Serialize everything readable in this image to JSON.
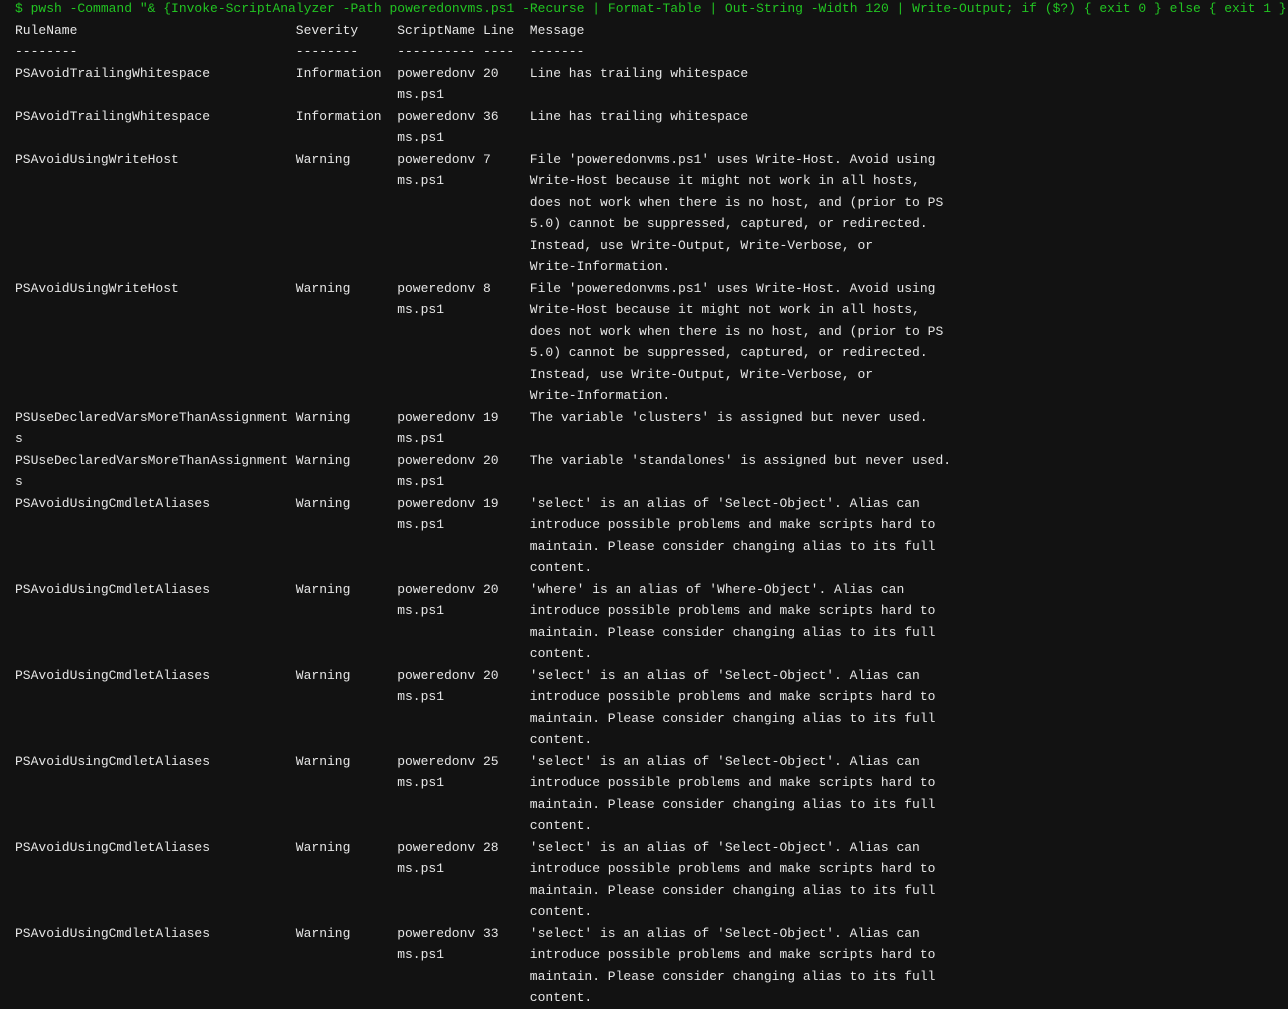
{
  "command": "$ pwsh -Command \"& {Invoke-ScriptAnalyzer -Path poweredonvms.ps1 -Recurse | Format-Table | Out-String -Width 120 | Write-Output; if ($?) { exit 0 } else { exit 1 }",
  "headers": {
    "rule": "RuleName",
    "severity": "Severity",
    "script": "ScriptName",
    "line": "Line",
    "message": "Message"
  },
  "separators": {
    "rule": "--------",
    "severity": "--------",
    "script": "----------",
    "line": "----",
    "message": "-------"
  },
  "rows": [
    {
      "rule": [
        "PSAvoidTrailingWhitespace"
      ],
      "severity": "Information",
      "script": [
        "poweredonv",
        "ms.ps1"
      ],
      "line": "20",
      "message": [
        "Line has trailing whitespace"
      ]
    },
    {
      "rule": [
        "PSAvoidTrailingWhitespace"
      ],
      "severity": "Information",
      "script": [
        "poweredonv",
        "ms.ps1"
      ],
      "line": "36",
      "message": [
        "Line has trailing whitespace"
      ]
    },
    {
      "rule": [
        "PSAvoidUsingWriteHost"
      ],
      "severity": "Warning",
      "script": [
        "poweredonv",
        "ms.ps1"
      ],
      "line": "7",
      "message": [
        "File 'poweredonvms.ps1' uses Write-Host. Avoid using",
        "Write-Host because it might not work in all hosts,",
        "does not work when there is no host, and (prior to PS",
        "5.0) cannot be suppressed, captured, or redirected.",
        "Instead, use Write-Output, Write-Verbose, or",
        "Write-Information."
      ]
    },
    {
      "rule": [
        "PSAvoidUsingWriteHost"
      ],
      "severity": "Warning",
      "script": [
        "poweredonv",
        "ms.ps1"
      ],
      "line": "8",
      "message": [
        "File 'poweredonvms.ps1' uses Write-Host. Avoid using",
        "Write-Host because it might not work in all hosts,",
        "does not work when there is no host, and (prior to PS",
        "5.0) cannot be suppressed, captured, or redirected.",
        "Instead, use Write-Output, Write-Verbose, or",
        "Write-Information."
      ]
    },
    {
      "rule": [
        "PSUseDeclaredVarsMoreThanAssignment",
        "s"
      ],
      "severity": "Warning",
      "script": [
        "poweredonv",
        "ms.ps1"
      ],
      "line": "19",
      "message": [
        "The variable 'clusters' is assigned but never used."
      ]
    },
    {
      "rule": [
        "PSUseDeclaredVarsMoreThanAssignment",
        "s"
      ],
      "severity": "Warning",
      "script": [
        "poweredonv",
        "ms.ps1"
      ],
      "line": "20",
      "message": [
        "The variable 'standalones' is assigned but never used."
      ]
    },
    {
      "rule": [
        "PSAvoidUsingCmdletAliases"
      ],
      "severity": "Warning",
      "script": [
        "poweredonv",
        "ms.ps1"
      ],
      "line": "19",
      "message": [
        "'select' is an alias of 'Select-Object'. Alias can",
        "introduce possible problems and make scripts hard to",
        "maintain. Please consider changing alias to its full",
        "content."
      ]
    },
    {
      "rule": [
        "PSAvoidUsingCmdletAliases"
      ],
      "severity": "Warning",
      "script": [
        "poweredonv",
        "ms.ps1"
      ],
      "line": "20",
      "message": [
        "'where' is an alias of 'Where-Object'. Alias can",
        "introduce possible problems and make scripts hard to",
        "maintain. Please consider changing alias to its full",
        "content."
      ]
    },
    {
      "rule": [
        "PSAvoidUsingCmdletAliases"
      ],
      "severity": "Warning",
      "script": [
        "poweredonv",
        "ms.ps1"
      ],
      "line": "20",
      "message": [
        "'select' is an alias of 'Select-Object'. Alias can",
        "introduce possible problems and make scripts hard to",
        "maintain. Please consider changing alias to its full",
        "content."
      ]
    },
    {
      "rule": [
        "PSAvoidUsingCmdletAliases"
      ],
      "severity": "Warning",
      "script": [
        "poweredonv",
        "ms.ps1"
      ],
      "line": "25",
      "message": [
        "'select' is an alias of 'Select-Object'. Alias can",
        "introduce possible problems and make scripts hard to",
        "maintain. Please consider changing alias to its full",
        "content."
      ]
    },
    {
      "rule": [
        "PSAvoidUsingCmdletAliases"
      ],
      "severity": "Warning",
      "script": [
        "poweredonv",
        "ms.ps1"
      ],
      "line": "28",
      "message": [
        "'select' is an alias of 'Select-Object'. Alias can",
        "introduce possible problems and make scripts hard to",
        "maintain. Please consider changing alias to its full",
        "content."
      ]
    },
    {
      "rule": [
        "PSAvoidUsingCmdletAliases"
      ],
      "severity": "Warning",
      "script": [
        "poweredonv",
        "ms.ps1"
      ],
      "line": "33",
      "message": [
        "'select' is an alias of 'Select-Object'. Alias can",
        "introduce possible problems and make scripts hard to",
        "maintain. Please consider changing alias to its full",
        "content."
      ]
    }
  ],
  "colors": {
    "background": "#121212",
    "text": "#e6e6e6",
    "command": "#22c422"
  }
}
